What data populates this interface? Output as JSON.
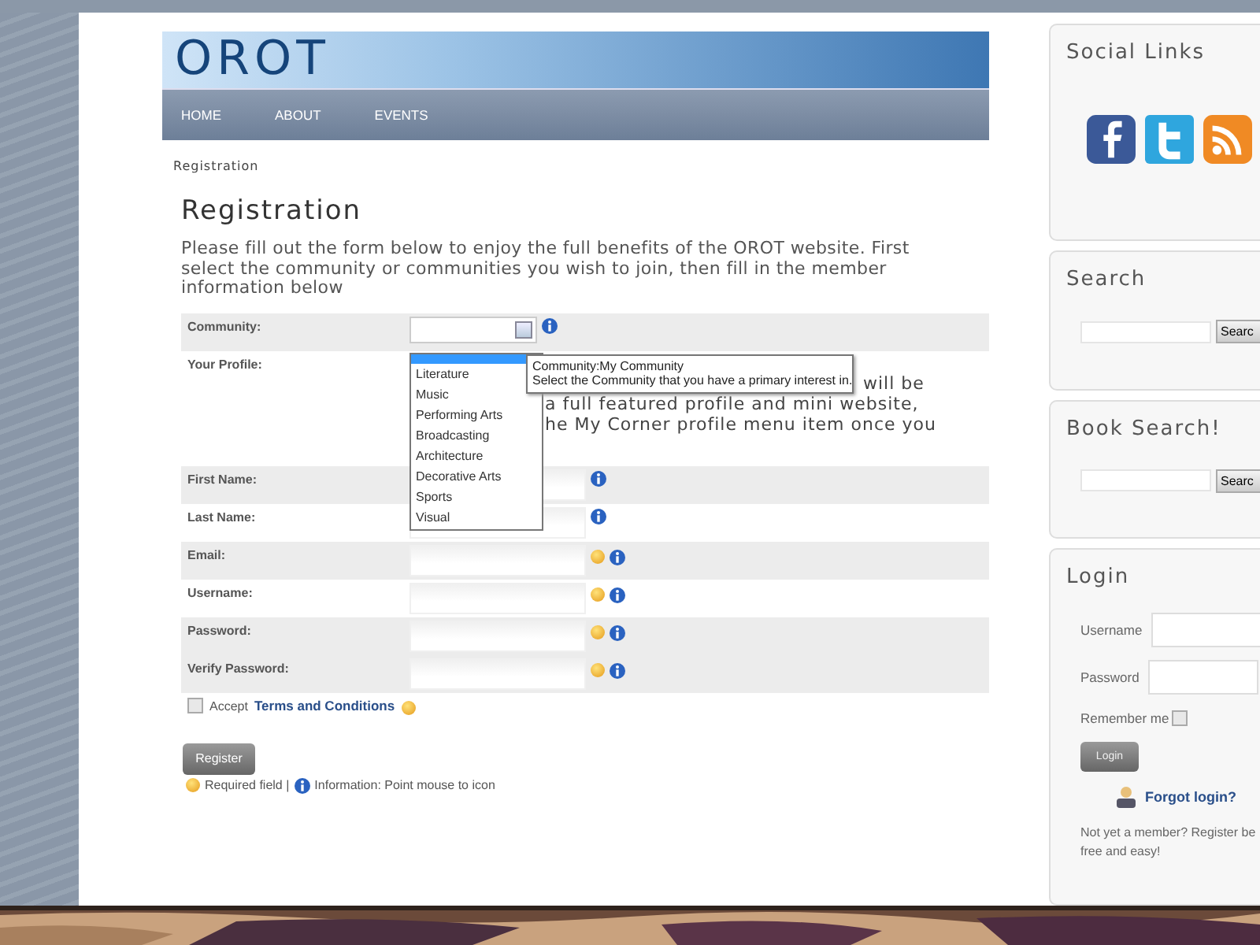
{
  "header": {
    "logo": "OROT"
  },
  "nav": [
    {
      "label": "HOME"
    },
    {
      "label": "ABOUT"
    },
    {
      "label": "EVENTS"
    }
  ],
  "breadcrumb": "Registration",
  "title": "Registration",
  "intro": "Please fill out the form below to enjoy the full benefits of the OROT website. First select the community or communities you wish to join, then fill in the member information below",
  "form": {
    "rows": [
      {
        "label": "Community:",
        "kind": "select",
        "shaded": true,
        "required": false,
        "info": true
      },
      {
        "label": "Your Profile:",
        "kind": "profile",
        "shaded": false,
        "required": false,
        "info": false,
        "lines": [
          "will be",
          "a full featured profile and mini website,",
          "he My Corner profile menu item once you"
        ]
      },
      {
        "label": "First Name:",
        "kind": "text",
        "shaded": true,
        "required": false,
        "info": true
      },
      {
        "label": "Last Name:",
        "kind": "text",
        "shaded": false,
        "required": false,
        "info": true
      },
      {
        "label": "Email:",
        "kind": "text",
        "shaded": true,
        "required": true,
        "info": true
      },
      {
        "label": "Username:",
        "kind": "text",
        "shaded": false,
        "required": true,
        "info": true
      },
      {
        "label": "Password:",
        "kind": "text",
        "shaded": true,
        "required": true,
        "info": true
      },
      {
        "label": "Verify Password:",
        "kind": "text",
        "shaded": true,
        "required": true,
        "info": true
      }
    ]
  },
  "dropdown": {
    "options": [
      "Literature",
      "Music",
      "Performing Arts",
      "Broadcasting",
      "Architecture",
      "Decorative Arts",
      "Sports",
      "Visual"
    ]
  },
  "tooltip": {
    "title": "Community:My Community",
    "text": "Select the Community that you have a primary interest in."
  },
  "terms": {
    "checked": false,
    "prefix": "Accept",
    "link": "Terms and Conditions",
    "required": true
  },
  "register_button": "Register",
  "legend": {
    "required": "Required field |",
    "info": "Information: Point mouse to icon"
  },
  "sidebar": {
    "social": {
      "title": "Social Links",
      "links": [
        {
          "kind": "facebook"
        },
        {
          "kind": "twitter"
        },
        {
          "kind": "rss"
        }
      ]
    },
    "search": {
      "title": "Search",
      "button": "Searc"
    },
    "book_search": {
      "title": "Book Search!",
      "button": "Searc"
    },
    "login": {
      "title": "Login",
      "username_label": "Username",
      "password_label": "Password",
      "remember_label": "Remember me",
      "remember_checked": false,
      "button": "Login",
      "forgot": "Forgot login?",
      "note_lines": [
        "Not yet a member? Register be",
        "free and easy!"
      ]
    }
  }
}
